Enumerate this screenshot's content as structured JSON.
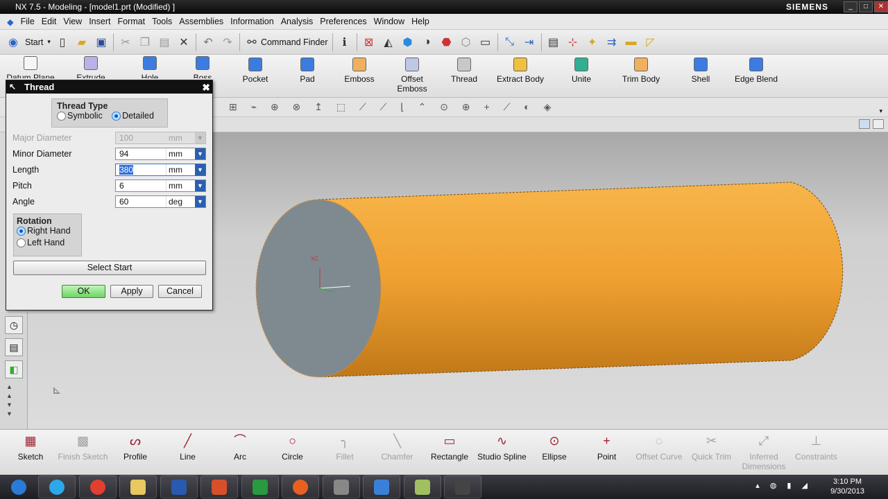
{
  "window": {
    "title": "NX 7.5 - Modeling - [model1.prt (Modified) ]",
    "brand": "SIEMENS"
  },
  "menu": [
    "File",
    "Edit",
    "View",
    "Insert",
    "Format",
    "Tools",
    "Assemblies",
    "Information",
    "Analysis",
    "Preferences",
    "Window",
    "Help"
  ],
  "toolbar": {
    "start_label": "Start",
    "command_finder_label": "Command Finder"
  },
  "features": [
    {
      "label": "Datum Plane",
      "color": "#f6f6f6"
    },
    {
      "label": "Extrude",
      "color": "#b9b2e8"
    },
    {
      "label": "Hole",
      "color": "#3c7ce0"
    },
    {
      "label": "Boss",
      "color": "#3c7ce0"
    },
    {
      "label": "Pocket",
      "color": "#3c7ce0"
    },
    {
      "label": "Pad",
      "color": "#3c7ce0"
    },
    {
      "label": "Emboss",
      "color": "#f0b060"
    },
    {
      "label": "Offset Emboss",
      "color": "#c0c8e8"
    },
    {
      "label": "Thread",
      "color": "#c8c8c8"
    },
    {
      "label": "Extract Body",
      "color": "#f0c040"
    },
    {
      "label": "Unite",
      "color": "#30b090"
    },
    {
      "label": "Trim Body",
      "color": "#f0b060"
    },
    {
      "label": "Shell",
      "color": "#3c7ce0"
    },
    {
      "label": "Edge Blend",
      "color": "#3c7ce0"
    }
  ],
  "dialog": {
    "title": "Thread",
    "thread_type": {
      "title": "Thread Type",
      "options": [
        "Symbolic",
        "Detailed"
      ],
      "selected": "Detailed"
    },
    "fields": [
      {
        "label": "Major Diameter",
        "value": "100",
        "unit": "mm",
        "disabled": true
      },
      {
        "label": "Minor Diameter",
        "value": "94",
        "unit": "mm"
      },
      {
        "label": "Length",
        "value": "380",
        "unit": "mm"
      },
      {
        "label": "Pitch",
        "value": "6",
        "unit": "mm"
      },
      {
        "label": "Angle",
        "value": "60",
        "unit": "deg"
      }
    ],
    "rotation": {
      "title": "Rotation",
      "options": [
        "Right Hand",
        "Left Hand"
      ],
      "selected": "Right Hand"
    },
    "select_start": "Select Start",
    "ok": "OK",
    "apply": "Apply",
    "cancel": "Cancel"
  },
  "viewport": {
    "body_color": "#f0a030",
    "face_color": "#7f8a90",
    "triad_label": "XC"
  },
  "sketch_toolbar": [
    {
      "label": "Sketch",
      "icon": "▦",
      "disabled": false
    },
    {
      "label": "Finish Sketch",
      "icon": "▩",
      "disabled": true
    },
    {
      "label": "Profile",
      "icon": "ᔕ",
      "disabled": false
    },
    {
      "label": "Line",
      "icon": "╱",
      "disabled": false
    },
    {
      "label": "Arc",
      "icon": "⌒",
      "disabled": false
    },
    {
      "label": "Circle",
      "icon": "○",
      "disabled": false
    },
    {
      "label": "Fillet",
      "icon": "╮",
      "disabled": true
    },
    {
      "label": "Chamfer",
      "icon": "╲",
      "disabled": true
    },
    {
      "label": "Rectangle",
      "icon": "▭",
      "disabled": false
    },
    {
      "label": "Studio Spline",
      "icon": "∿",
      "disabled": false
    },
    {
      "label": "Ellipse",
      "icon": "⊙",
      "disabled": false
    },
    {
      "label": "Point",
      "icon": "+",
      "disabled": false
    },
    {
      "label": "Offset Curve",
      "icon": "◌",
      "disabled": true
    },
    {
      "label": "Quick Trim",
      "icon": "✂",
      "disabled": true
    },
    {
      "label": "Inferred Dimensions",
      "icon": "⤢",
      "disabled": true
    },
    {
      "label": "Constraints",
      "icon": "⊥",
      "disabled": true
    }
  ],
  "taskbar": {
    "apps": [
      "Start",
      "Skype",
      "Chrome",
      "Explorer",
      "Word",
      "PowerPoint",
      "Excel",
      "Firefox",
      "Webcam",
      "NX",
      "Notes",
      "Recorder"
    ],
    "time": "3:10 PM",
    "date": "9/30/2013"
  }
}
